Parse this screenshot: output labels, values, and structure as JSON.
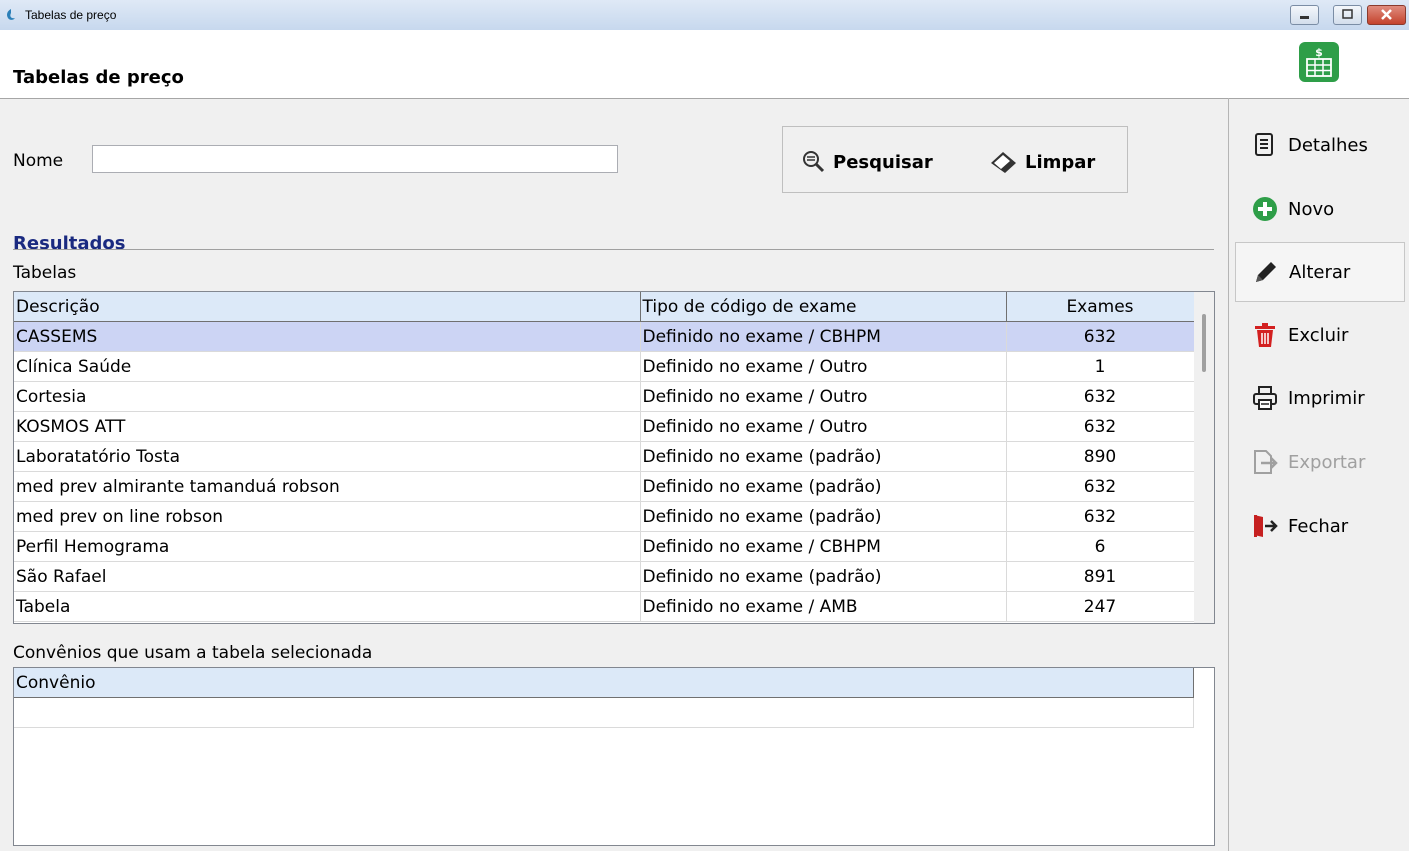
{
  "window": {
    "title": "Tabelas de preço"
  },
  "header": {
    "page_title": "Tabelas de preço"
  },
  "search": {
    "name_label": "Nome",
    "name_value": "",
    "search_button": "Pesquisar",
    "clear_button": "Limpar"
  },
  "results": {
    "section_title": "Resultados",
    "tables_label": "Tabelas",
    "columns": [
      "Descrição",
      "Tipo de código de exame",
      "Exames"
    ],
    "rows": [
      {
        "descricao": "CASSEMS",
        "tipo": "Definido no exame / CBHPM",
        "exames": "632"
      },
      {
        "descricao": "Clínica Saúde",
        "tipo": "Definido no exame / Outro",
        "exames": "1"
      },
      {
        "descricao": "Cortesia",
        "tipo": "Definido no exame / Outro",
        "exames": "632"
      },
      {
        "descricao": "KOSMOS ATT",
        "tipo": "Definido no exame / Outro",
        "exames": "632"
      },
      {
        "descricao": "Laboratatório Tosta",
        "tipo": "Definido no exame (padrão)",
        "exames": "890"
      },
      {
        "descricao": "med prev almirante tamanduá robson",
        "tipo": "Definido no exame (padrão)",
        "exames": "632"
      },
      {
        "descricao": "med prev on line robson",
        "tipo": "Definido no exame (padrão)",
        "exames": "632"
      },
      {
        "descricao": "Perfil Hemograma",
        "tipo": "Definido no exame / CBHPM",
        "exames": "6"
      },
      {
        "descricao": "São Rafael",
        "tipo": "Definido no exame (padrão)",
        "exames": "891"
      },
      {
        "descricao": "Tabela",
        "tipo": "Definido no exame / AMB",
        "exames": "247"
      }
    ],
    "selected_index": 0
  },
  "convenios": {
    "label": "Convênios que usam a tabela selecionada",
    "columns": [
      "Convênio"
    ]
  },
  "actions": {
    "detalhes": "Detalhes",
    "novo": "Novo",
    "alterar": "Alterar",
    "excluir": "Excluir",
    "imprimir": "Imprimir",
    "exportar": "Exportar",
    "fechar": "Fechar"
  },
  "colors": {
    "selected_row": "#ccd4f4",
    "header_bg": "#dce9f8",
    "section_title": "#1a2a80"
  }
}
